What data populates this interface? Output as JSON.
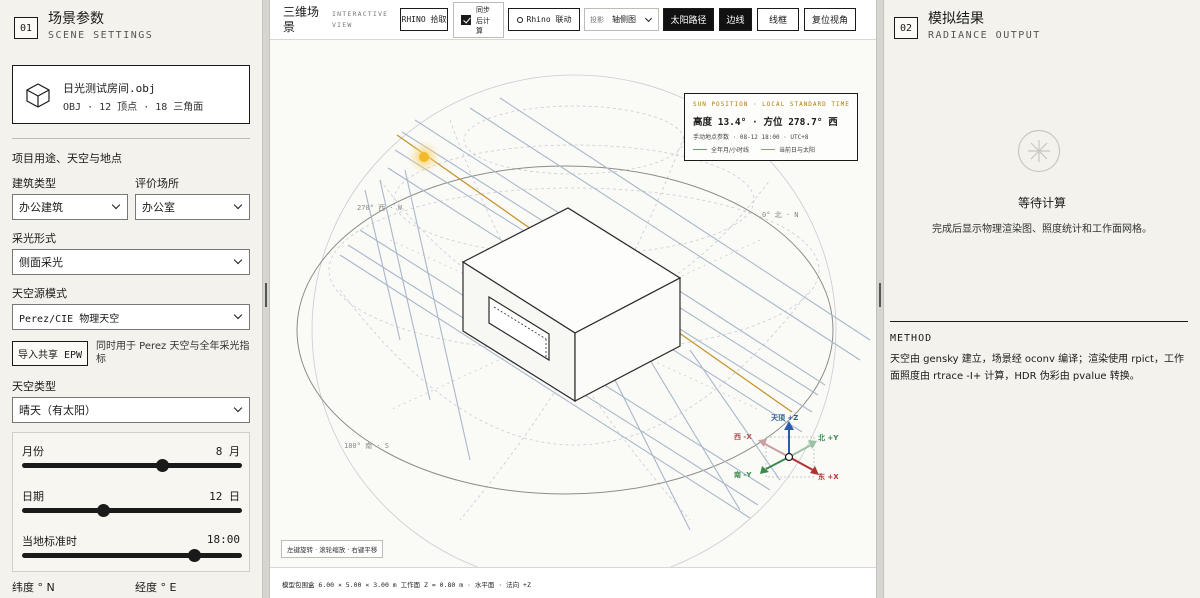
{
  "left": {
    "num": "01",
    "title": "场景参数",
    "subtitle": "SCENE SETTINGS",
    "file": {
      "name": "日光测试房间.obj",
      "meta": "OBJ · 12 顶点 · 18 三角面"
    },
    "section_title": "项目用途、天空与地点",
    "building_type": {
      "label": "建筑类型",
      "value": "办公建筑"
    },
    "eval_place": {
      "label": "评价场所",
      "value": "办公室"
    },
    "daylight_form": {
      "label": "采光形式",
      "value": "侧面采光"
    },
    "sky_source": {
      "label": "天空源模式",
      "value": "Perez/CIE 物理天空"
    },
    "epw_button": "导入共享 EPW",
    "epw_note": "同时用于 Perez 天空与全年采光指标",
    "sky_type": {
      "label": "天空类型",
      "value": "晴天（有太阳）"
    },
    "sliders": {
      "month": {
        "label": "月份",
        "value": "8 月",
        "fraction": 0.636
      },
      "day": {
        "label": "日期",
        "value": "12 日",
        "fraction": 0.367
      },
      "time": {
        "label": "当地标准时",
        "value": "18:00",
        "fraction": 0.783
      }
    },
    "latitude_label": "纬度 ° N",
    "longitude_label": "经度 ° E"
  },
  "center": {
    "title": "三维场景",
    "subtitle": "INTERACTIVE VIEW",
    "toolbar": {
      "rhino_pick": "RHINO 拾取",
      "sync_label": "同步后计算",
      "sync_checked": true,
      "rhino_link": "Rhino 联动",
      "projection_label": "投影",
      "projection_value": "轴侧图",
      "sun_path": "太阳路径",
      "edges": "边线",
      "wireframe": "线框",
      "reset_view": "复位视角"
    },
    "legend": {
      "header": "SUN POSITION · LOCAL STANDARD TIME",
      "main": "高度 13.4° · 方位 278.7° 西",
      "sub": "手动地点参数 · 08-12 18:00 · UTC+8",
      "key_all": "全年月/小时线",
      "key_today": "当前日与太阳",
      "color_all": "#6f88ad",
      "color_today": "#c39128"
    },
    "compass_labels": {
      "west": "270° 西 · W",
      "north": "0° 北 · N",
      "south": "180° 南 · S"
    },
    "axes": {
      "zenith": "天顶 +Z",
      "west": "西 -X",
      "north": "北 +Y",
      "south": "南 -Y",
      "east": "东 +X"
    },
    "hint": "左键旋转 · 滚轮缩放 · 右键平移",
    "status": "模型包围盒 6.00 × 5.00 × 3.00 m   工作面 Z = 0.80 m · 水平面 · 法向 +Z"
  },
  "right": {
    "num": "02",
    "title": "模拟结果",
    "subtitle": "RADIANCE OUTPUT",
    "wait_title": "等待计算",
    "wait_sub": "完成后显示物理渲染图、照度统计和工作面网格。",
    "method_header": "METHOD",
    "method_text": "天空由 gensky 建立，场景经 oconv 编译；渲染使用 rpict，工作面照度由 rtrace -I+ 计算，HDR 伪彩由 pvalue 转换。"
  }
}
